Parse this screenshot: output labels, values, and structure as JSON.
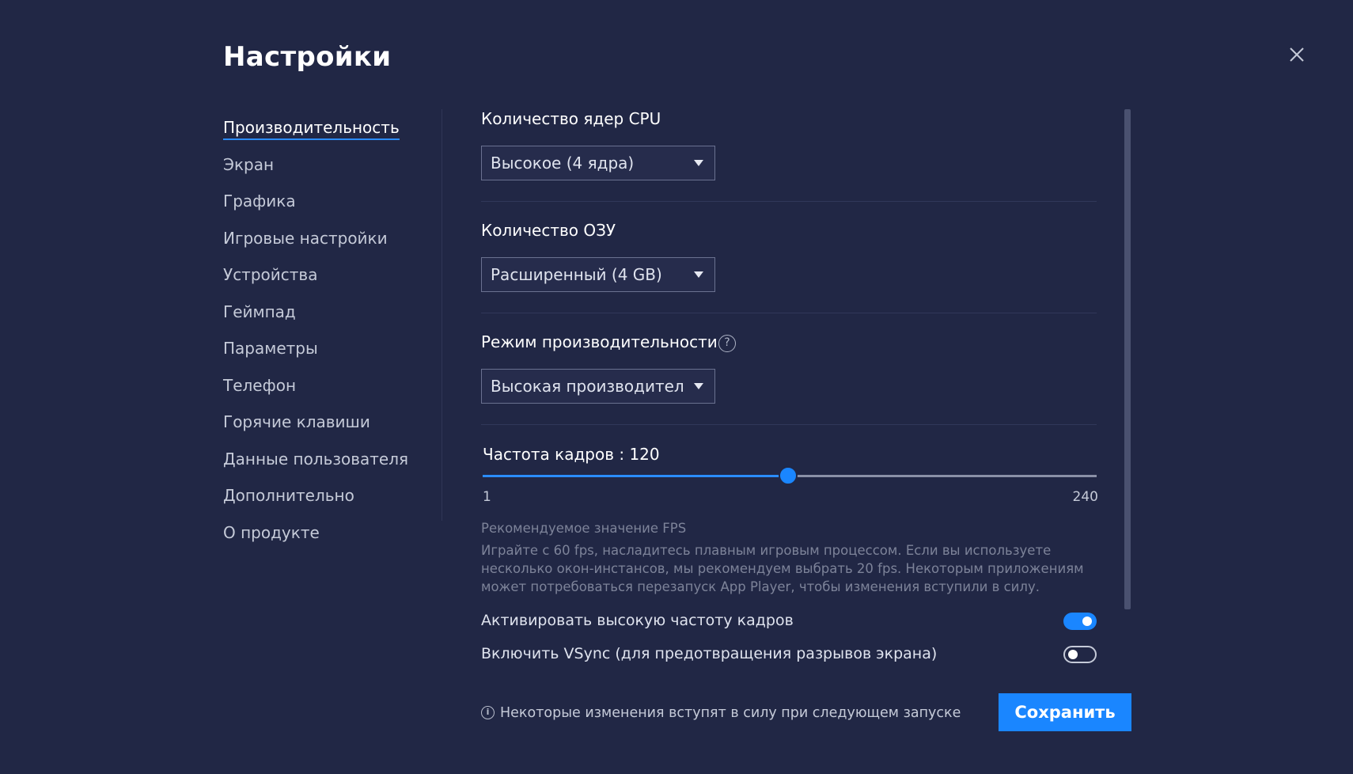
{
  "title": "Настройки",
  "close_icon": "close-icon",
  "sidebar": {
    "items": [
      {
        "label": "Производительность",
        "active": true
      },
      {
        "label": "Экран"
      },
      {
        "label": "Графика"
      },
      {
        "label": "Игровые настройки"
      },
      {
        "label": "Устройства"
      },
      {
        "label": "Геймпад"
      },
      {
        "label": "Параметры"
      },
      {
        "label": "Телефон"
      },
      {
        "label": "Горячие клавиши"
      },
      {
        "label": "Данные пользователя"
      },
      {
        "label": "Дополнительно"
      },
      {
        "label": "О продукте"
      }
    ]
  },
  "cpu": {
    "label": "Количество ядер CPU",
    "value": "Высокое (4 ядра)"
  },
  "ram": {
    "label": "Количество ОЗУ",
    "value": "Расширенный (4 GB)"
  },
  "perf_mode": {
    "label": "Режим производительности",
    "help_glyph": "?",
    "value": "Высокая производительность"
  },
  "fps": {
    "label": "Частота кадров : 120",
    "value": 120,
    "min": 1,
    "max": 240,
    "min_label": "1",
    "max_label": "240",
    "hint_title": "Рекомендуемое значение FPS",
    "hint_text": "Играйте с 60 fps, насладитесь плавным игровым процессом. Если вы используете несколько окон-инстансов, мы рекомендуем выбрать 20 fps. Некоторым приложениям может потребоваться перезапуск App Player, чтобы изменения вступили в силу."
  },
  "toggles": {
    "high_fps": {
      "label": "Активировать высокую частоту кадров",
      "on": true
    },
    "vsync": {
      "label": "Включить VSync (для предотвращения разрывов экрана)",
      "on": false
    }
  },
  "footer": {
    "info_glyph": "i",
    "note": "Некоторые изменения вступят в силу при следующем запуске",
    "save_label": "Сохранить"
  },
  "colors": {
    "background": "#212745",
    "accent": "#1a86ff"
  }
}
